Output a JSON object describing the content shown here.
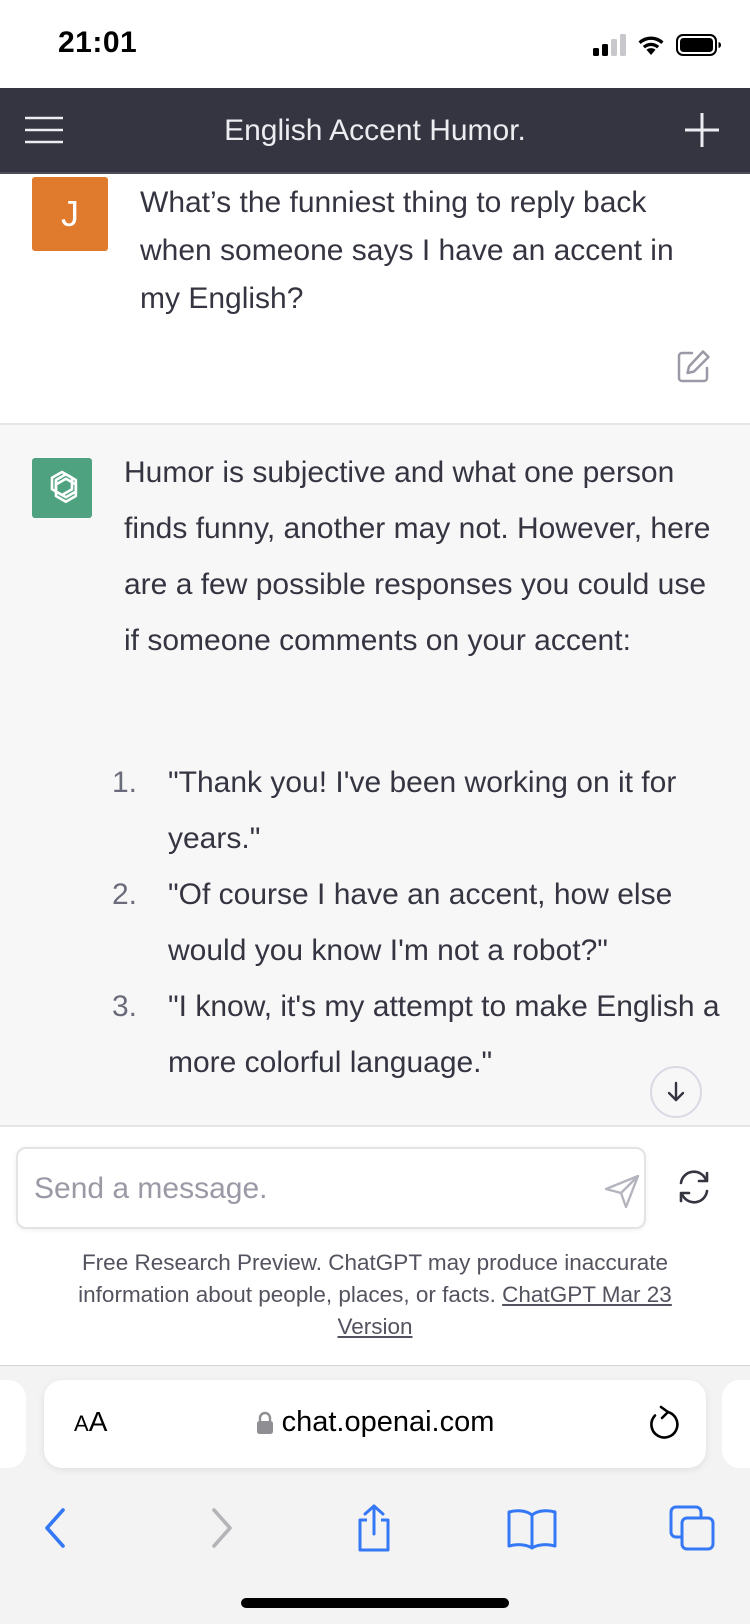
{
  "status_bar": {
    "time": "21:01",
    "icons": [
      "signal-icon",
      "wifi-icon",
      "battery-icon"
    ]
  },
  "header": {
    "title": "English Accent Humor.",
    "menu_icon": "hamburger-menu-icon",
    "new_chat_icon": "plus-icon"
  },
  "user_message": {
    "avatar_initial": "J",
    "avatar_color": "#e07a2c",
    "text": "What’s the funniest thing to reply back when someone says I have an accent in my English?",
    "edit_icon": "edit-icon"
  },
  "assistant_message": {
    "avatar_color": "#4fa27f",
    "intro": "Humor is subjective and what one person finds funny, another may not. However, here are a few possible responses you could use if someone comments on your accent:",
    "responses": [
      {
        "number": "1.",
        "text": "\"Thank you! I've been working on it for years.\""
      },
      {
        "number": "2.",
        "text": "\"Of course I have an accent, how else would you know I'm not a robot?\""
      },
      {
        "number": "3.",
        "text": "\"I know, it's my attempt to make English a more colorful language.\""
      }
    ]
  },
  "composer": {
    "placeholder": "Send a message.",
    "send_icon": "paper-plane-icon",
    "regenerate_icon": "regenerate-icon",
    "disclaimer_text": "Free Research Preview. ChatGPT may produce inaccurate information about people, places, or facts. ",
    "disclaimer_link": "ChatGPT Mar 23 Version"
  },
  "browser": {
    "text_size_label_large": "A",
    "text_size_label_small": "A",
    "url": "chat.openai.com",
    "toolbar_icons": [
      "back-icon",
      "forward-icon",
      "share-icon",
      "bookmarks-icon",
      "tabs-icon"
    ],
    "accent_color": "#3478f6"
  }
}
